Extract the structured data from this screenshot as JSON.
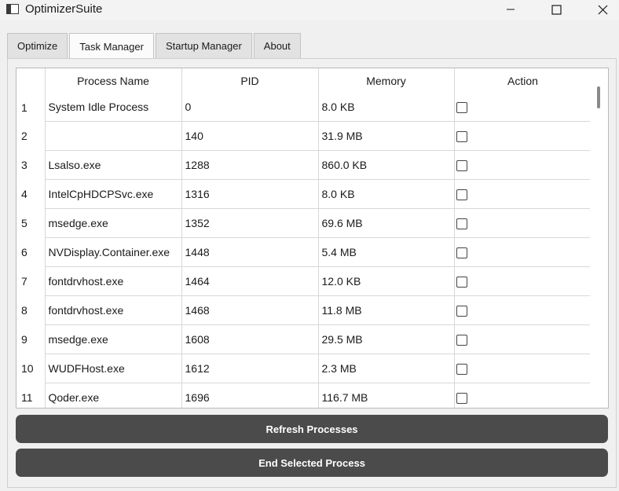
{
  "window": {
    "title": "OptimizerSuite"
  },
  "tabs": [
    {
      "label": "Optimize",
      "active": false
    },
    {
      "label": "Task Manager",
      "active": true
    },
    {
      "label": "Startup Manager",
      "active": false
    },
    {
      "label": "About",
      "active": false
    }
  ],
  "table": {
    "columns": [
      "Process Name",
      "PID",
      "Memory",
      "Action"
    ],
    "rows": [
      {
        "num": "1",
        "name": "System Idle Process",
        "pid": "0",
        "memory": "8.0 KB",
        "checked": false
      },
      {
        "num": "2",
        "name": "",
        "pid": "140",
        "memory": "31.9 MB",
        "checked": false
      },
      {
        "num": "3",
        "name": "Lsalso.exe",
        "pid": "1288",
        "memory": "860.0 KB",
        "checked": false
      },
      {
        "num": "4",
        "name": "IntelCpHDCPSvc.exe",
        "pid": "1316",
        "memory": "8.0 KB",
        "checked": false
      },
      {
        "num": "5",
        "name": "msedge.exe",
        "pid": "1352",
        "memory": "69.6 MB",
        "checked": false
      },
      {
        "num": "6",
        "name": "NVDisplay.Container.exe",
        "pid": "1448",
        "memory": "5.4 MB",
        "checked": false
      },
      {
        "num": "7",
        "name": "fontdrvhost.exe",
        "pid": "1464",
        "memory": "12.0 KB",
        "checked": false
      },
      {
        "num": "8",
        "name": "fontdrvhost.exe",
        "pid": "1468",
        "memory": "11.8 MB",
        "checked": false
      },
      {
        "num": "9",
        "name": "msedge.exe",
        "pid": "1608",
        "memory": "29.5 MB",
        "checked": false
      },
      {
        "num": "10",
        "name": "WUDFHost.exe",
        "pid": "1612",
        "memory": "2.3 MB",
        "checked": false
      },
      {
        "num": "11",
        "name": "Qoder.exe",
        "pid": "1696",
        "memory": "116.7 MB",
        "checked": false
      }
    ]
  },
  "buttons": {
    "refresh": "Refresh Processes",
    "end": "End Selected Process"
  },
  "colors": {
    "button_bg": "#4b4b4b",
    "button_text": "#ffffff",
    "window_bg": "#f0f0f0"
  },
  "icons": {
    "app": "app-window-icon",
    "minimize": "minimize-icon",
    "maximize": "maximize-icon",
    "close": "close-icon"
  }
}
